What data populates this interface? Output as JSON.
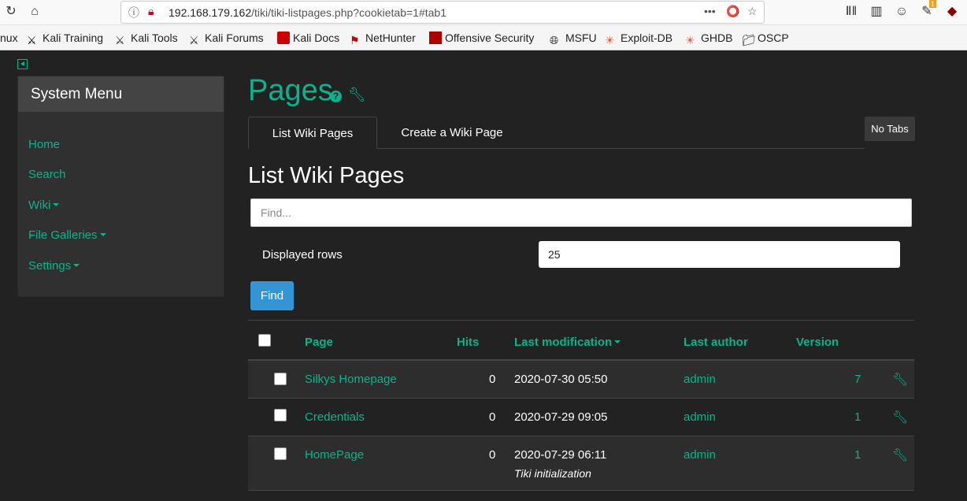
{
  "browser": {
    "url_host": "192.168.179.162",
    "url_path": "/tiki/tiki-listpages.php?cookietab=1#tab1",
    "badge_count": "1",
    "bookmarks": [
      "nux",
      "Kali Training",
      "Kali Tools",
      "Kali Forums",
      "Kali Docs",
      "NetHunter",
      "Offensive Security",
      "MSFU",
      "Exploit-DB",
      "GHDB",
      "OSCP"
    ]
  },
  "sidebar": {
    "title": "System Menu",
    "items": [
      "Home",
      "Search",
      "Wiki",
      "File Galleries",
      "Settings"
    ]
  },
  "page": {
    "title": "Pages",
    "tabs": [
      "List Wiki Pages",
      "Create a Wiki Page"
    ],
    "no_tabs_label": "No Tabs",
    "section_title": "List Wiki Pages",
    "find_placeholder": "Find...",
    "displayed_rows_label": "Displayed rows",
    "displayed_rows_value": "25",
    "find_button": "Find"
  },
  "table": {
    "headers": {
      "page": "Page",
      "hits": "Hits",
      "last_modification": "Last modification",
      "last_author": "Last author",
      "version": "Version"
    },
    "rows": [
      {
        "page": "Silkys Homepage",
        "hits": "0",
        "modified": "2020-07-30 05:50",
        "author": "admin",
        "version": "7",
        "comment": ""
      },
      {
        "page": "Credentials",
        "hits": "0",
        "modified": "2020-07-29 09:05",
        "author": "admin",
        "version": "1",
        "comment": ""
      },
      {
        "page": "HomePage",
        "hits": "0",
        "modified": "2020-07-29 06:11",
        "author": "admin",
        "version": "1",
        "comment": "Tiki initialization"
      }
    ]
  }
}
